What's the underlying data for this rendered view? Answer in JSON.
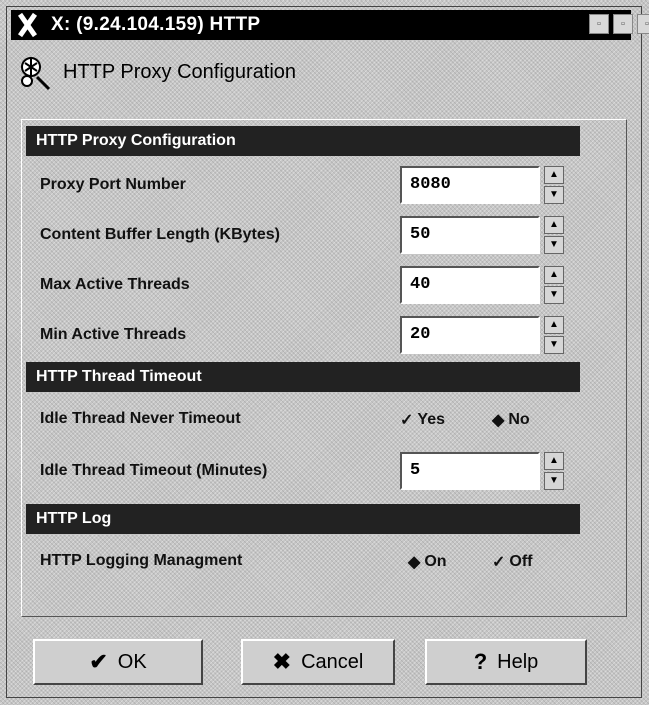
{
  "window": {
    "title": "X: (9.24.104.159) HTTP"
  },
  "header": {
    "title": "HTTP Proxy Configuration"
  },
  "sections": {
    "proxy": "HTTP Proxy Configuration",
    "timeout": "HTTP Thread Timeout",
    "log": "HTTP Log"
  },
  "fields": {
    "port": {
      "label": "Proxy Port Number",
      "value": "8080"
    },
    "buffer": {
      "label": "Content Buffer Length (KBytes)",
      "value": "50"
    },
    "max_threads": {
      "label": "Max Active Threads",
      "value": "40"
    },
    "min_threads": {
      "label": "Min Active Threads",
      "value": "20"
    },
    "idle_timeout": {
      "label": "Idle Thread Timeout (Minutes)",
      "value": "5"
    }
  },
  "radios": {
    "never_timeout": {
      "label": "Idle Thread Never Timeout",
      "yes": "Yes",
      "no": "No",
      "selected": "Yes"
    },
    "logging": {
      "label": "HTTP Logging Managment",
      "on": "On",
      "off": "Off",
      "selected": "Off"
    }
  },
  "buttons": {
    "ok": "OK",
    "cancel": "Cancel",
    "help": "Help"
  }
}
